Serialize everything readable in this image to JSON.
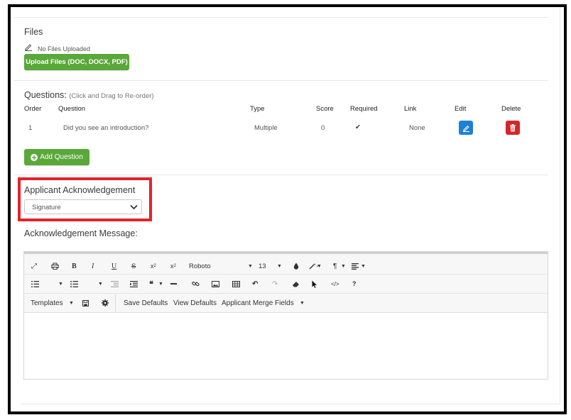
{
  "files": {
    "title": "Files",
    "no_files": "No Files Uploaded",
    "upload_button": "Upload Files (DOC, DOCX, PDF)"
  },
  "questions": {
    "title": "Questions:",
    "hint": "(Click and Drag to Re-order)",
    "columns": [
      "Order",
      "Question",
      "Type",
      "Score",
      "Required",
      "Link",
      "Edit",
      "Delete"
    ],
    "rows": [
      {
        "order": "1",
        "question": "Did you see an introduction?",
        "type": "Multiple",
        "score": "0",
        "required": "✔",
        "link": "None"
      }
    ],
    "add_button": "Add Question"
  },
  "acknowledgement": {
    "title": "Applicant Acknowledgement",
    "selected": "Signature",
    "message_label": "Acknowledgement Message:"
  },
  "editor": {
    "font": "Roboto",
    "size": "13",
    "templates": "Templates",
    "save_defaults": "Save Defaults",
    "view_defaults": "View Defaults",
    "merge_fields": "Applicant Merge Fields"
  },
  "colors": {
    "green": "#5aa83a",
    "edit_blue": "#1d7fd6",
    "delete_red": "#d6262b",
    "highlight": "#e3232b"
  }
}
